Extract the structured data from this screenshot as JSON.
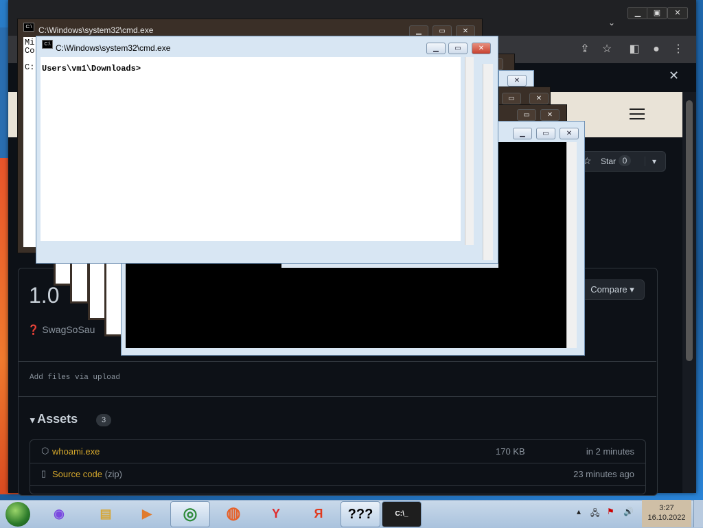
{
  "browser": {
    "star_label": "Star",
    "star_count": "0",
    "version": "1.0",
    "author": "SwagSoSau",
    "compare_label": "Compare",
    "upload_note": "Add files via upload",
    "assets_title": "Assets",
    "assets_count": "3",
    "assets": [
      {
        "name": "whoami.exe",
        "size": "170 KB",
        "time": "in 2 minutes"
      },
      {
        "name": "Source code",
        "suffix": "(zip)",
        "size": "",
        "time": "23 minutes ago"
      }
    ]
  },
  "cmd_back": {
    "title": "C:\\Windows\\system32\\cmd.exe",
    "lines": [
      "Mi",
      "Co",
      "",
      "C:"
    ]
  },
  "cmd_front": {
    "title": "C:\\Windows\\system32\\cmd.exe",
    "prompt": "Users\\vm1\\Downloads>"
  },
  "taskbar": {
    "apps": [
      {
        "icon": "alice-icon",
        "glyph": "◉"
      },
      {
        "icon": "folder-icon",
        "glyph": "▤"
      },
      {
        "icon": "media-player-icon",
        "glyph": "▶"
      },
      {
        "icon": "chrome-icon",
        "glyph": "◎"
      },
      {
        "icon": "firefox-icon",
        "glyph": "◍"
      },
      {
        "icon": "yandex-browser-icon",
        "glyph": "Y"
      },
      {
        "icon": "yandex-icon",
        "glyph": "Я"
      },
      {
        "icon": "unknown-app-icon",
        "glyph": "???"
      },
      {
        "icon": "cmd-icon",
        "glyph": "C:\\_"
      }
    ],
    "time": "3:27",
    "date": "16.10.2022"
  },
  "colors": {
    "accent": "#d4a72c",
    "github_bg": "#0d1117",
    "taskbar": "#b9cde3"
  }
}
